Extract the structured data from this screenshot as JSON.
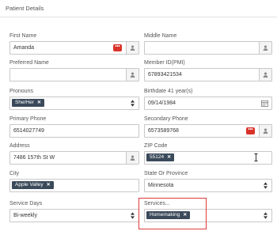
{
  "header": {
    "title": "Patient Details"
  },
  "fields": {
    "first_name": {
      "label": "First Name",
      "value": "Amanda"
    },
    "middle_name": {
      "label": "Middle Name",
      "value": ""
    },
    "preferred_name": {
      "label": "Preferred Name",
      "value": ""
    },
    "member_id": {
      "label": "Member ID(PMI)",
      "value": "67893421534"
    },
    "pronouns": {
      "label": "Pronouns",
      "chip": "She/Her"
    },
    "birthdate": {
      "label": "Birthdate  41 year(s)",
      "value": "09/14/1984"
    },
    "primary_phone": {
      "label": "Primary Phone",
      "value": "6514027749"
    },
    "secondary_phone": {
      "label": "Secondary Phone",
      "value": "6573589768"
    },
    "address": {
      "label": "Address",
      "value": "7486 157th St W"
    },
    "zip_code": {
      "label": "ZIP Code",
      "chip": "55124"
    },
    "city": {
      "label": "City",
      "chip": "Apple Valley"
    },
    "state": {
      "label": "State Or Province",
      "value": "Minnesota"
    },
    "service_days": {
      "label": "Service Days",
      "value": "Bi-weekly"
    },
    "services": {
      "label": "Services...",
      "chip": "Homemaking"
    }
  },
  "icons": {
    "person": "person-icon",
    "more": "more-icon",
    "calendar": "calendar-icon",
    "updown": "chevron-updown-icon",
    "remove": "close-icon",
    "text_cursor": "text-cursor-icon"
  },
  "colors": {
    "chip_bg": "#3b4a5a",
    "alert_button": "#d9322a",
    "highlight": "#e03a3a"
  }
}
